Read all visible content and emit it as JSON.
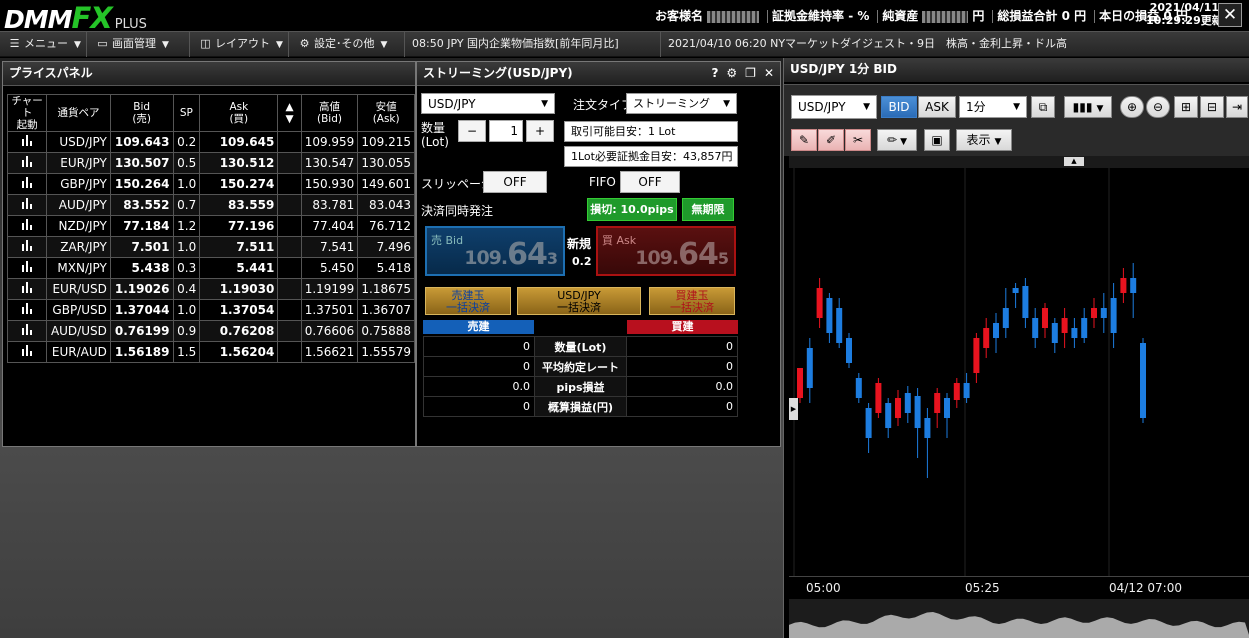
{
  "header": {
    "logo_main": "DMM",
    "logo_fx": "FX",
    "logo_plus": "PLUS",
    "customer_label": "お客様名",
    "margin_ratio": "証拠金維持率 - %",
    "net_assets_label": "純資産",
    "net_assets_unit": "円",
    "total_pl": "総損益合計 0 円",
    "today_pl": "本日の損益 0 円",
    "update_date": "2021/04/11",
    "update_time": "10:29:29更新",
    "close": "✕"
  },
  "menubar": {
    "menu": "メニュー",
    "screen": "画面管理",
    "layout": "レイアウト",
    "settings": "設定･その他",
    "ticker1": "08:50 JPY 国内企業物価指数[前年同月比]",
    "ticker2": "2021/04/10 06:20 NYマーケットダイジェスト・9日　株高・金利上昇・ドル高"
  },
  "price_panel": {
    "title": "プライスパネル",
    "columns": [
      "チャート起動",
      "通貨ペア",
      "Bid(売)",
      "SP",
      "Ask(買)",
      "▲▼",
      "高値(Bid)",
      "安値(Ask)"
    ],
    "col_html": {
      "chart": [
        "チャート",
        "起動"
      ],
      "pair": "通貨ペア",
      "bid": [
        "Bid",
        "(売)"
      ],
      "sp": "SP",
      "ask": [
        "Ask",
        "(買)"
      ],
      "sort": [
        "▲",
        "▼"
      ],
      "high": [
        "高値",
        "(Bid)"
      ],
      "low": [
        "安値",
        "(Ask)"
      ]
    },
    "rows": [
      {
        "pair": "USD/JPY",
        "bid": "109.643",
        "sp": "0.2",
        "ask": "109.645",
        "high": "109.959",
        "low": "109.215"
      },
      {
        "pair": "EUR/JPY",
        "bid": "130.507",
        "sp": "0.5",
        "ask": "130.512",
        "high": "130.547",
        "low": "130.055"
      },
      {
        "pair": "GBP/JPY",
        "bid": "150.264",
        "sp": "1.0",
        "ask": "150.274",
        "high": "150.930",
        "low": "149.601"
      },
      {
        "pair": "AUD/JPY",
        "bid": "83.552",
        "sp": "0.7",
        "ask": "83.559",
        "high": "83.781",
        "low": "83.043"
      },
      {
        "pair": "NZD/JPY",
        "bid": "77.184",
        "sp": "1.2",
        "ask": "77.196",
        "high": "77.404",
        "low": "76.712"
      },
      {
        "pair": "ZAR/JPY",
        "bid": "7.501",
        "sp": "1.0",
        "ask": "7.511",
        "high": "7.541",
        "low": "7.496"
      },
      {
        "pair": "MXN/JPY",
        "bid": "5.438",
        "sp": "0.3",
        "ask": "5.441",
        "high": "5.450",
        "low": "5.418"
      },
      {
        "pair": "EUR/USD",
        "bid": "1.19026",
        "sp": "0.4",
        "ask": "1.19030",
        "high": "1.19199",
        "low": "1.18675"
      },
      {
        "pair": "GBP/USD",
        "bid": "1.37044",
        "sp": "1.0",
        "ask": "1.37054",
        "high": "1.37501",
        "low": "1.36707"
      },
      {
        "pair": "AUD/USD",
        "bid": "0.76199",
        "sp": "0.9",
        "ask": "0.76208",
        "high": "0.76606",
        "low": "0.75888"
      },
      {
        "pair": "EUR/AUD",
        "bid": "1.56189",
        "sp": "1.5",
        "ask": "1.56204",
        "high": "1.56621",
        "low": "1.55579"
      }
    ]
  },
  "streaming": {
    "title": "ストリーミング(USD/JPY)",
    "tools": {
      "help": "?",
      "gear": "⚙",
      "popout": "❐",
      "close": "✕"
    },
    "pair": "USD/JPY",
    "order_type_label": "注文タイプ",
    "order_type": "ストリーミング",
    "qty_label_1": "数量",
    "qty_label_2": "(Lot)",
    "qty_minus": "−",
    "qty_value": "1",
    "qty_plus": "+",
    "tradable": "取引可能目安：1 Lot",
    "margin_needed": "1Lot必要証拠金目安：43,857円",
    "slippage_label": "スリッページ",
    "slippage_value": "OFF",
    "fifo_label": "FIFO",
    "fifo_value": "OFF",
    "settle_label": "決済同時発注",
    "stoploss": "損切: 10.0pips",
    "unlimited": "無期限",
    "bid_label": "売 Bid",
    "bid_p1": "109.",
    "bid_p2": "64",
    "bid_p3": "3",
    "new_label": "新規",
    "spread": "0.2",
    "ask_label": "買 Ask",
    "ask_p1": "109.",
    "ask_p2": "64",
    "ask_p3": "5",
    "sell_close_1": "売建玉",
    "sell_close_2": "一括決済",
    "pair_close_1": "USD/JPY",
    "pair_close_2": "一括決済",
    "buy_close_1": "買建玉",
    "buy_close_2": "一括決済",
    "sell_header": "売建",
    "buy_header": "買建",
    "positions": [
      {
        "sell": "0",
        "label": "数量(Lot)",
        "buy": "0"
      },
      {
        "sell": "0",
        "label": "平均約定レート",
        "buy": "0"
      },
      {
        "sell": "0.0",
        "label": "pips損益",
        "buy": "0.0"
      },
      {
        "sell": "0",
        "label": "概算損益(円)",
        "buy": "0"
      }
    ]
  },
  "chart": {
    "title": "USD/JPY 1分 BID",
    "pair": "USD/JPY",
    "bid": "BID",
    "ask": "ASK",
    "period": "1分",
    "display": "表示",
    "x_ticks": [
      "05:00",
      "05:25",
      "04/12 07:00"
    ],
    "colors": {
      "up": "#e8131f",
      "down": "#1d7de0"
    }
  }
}
